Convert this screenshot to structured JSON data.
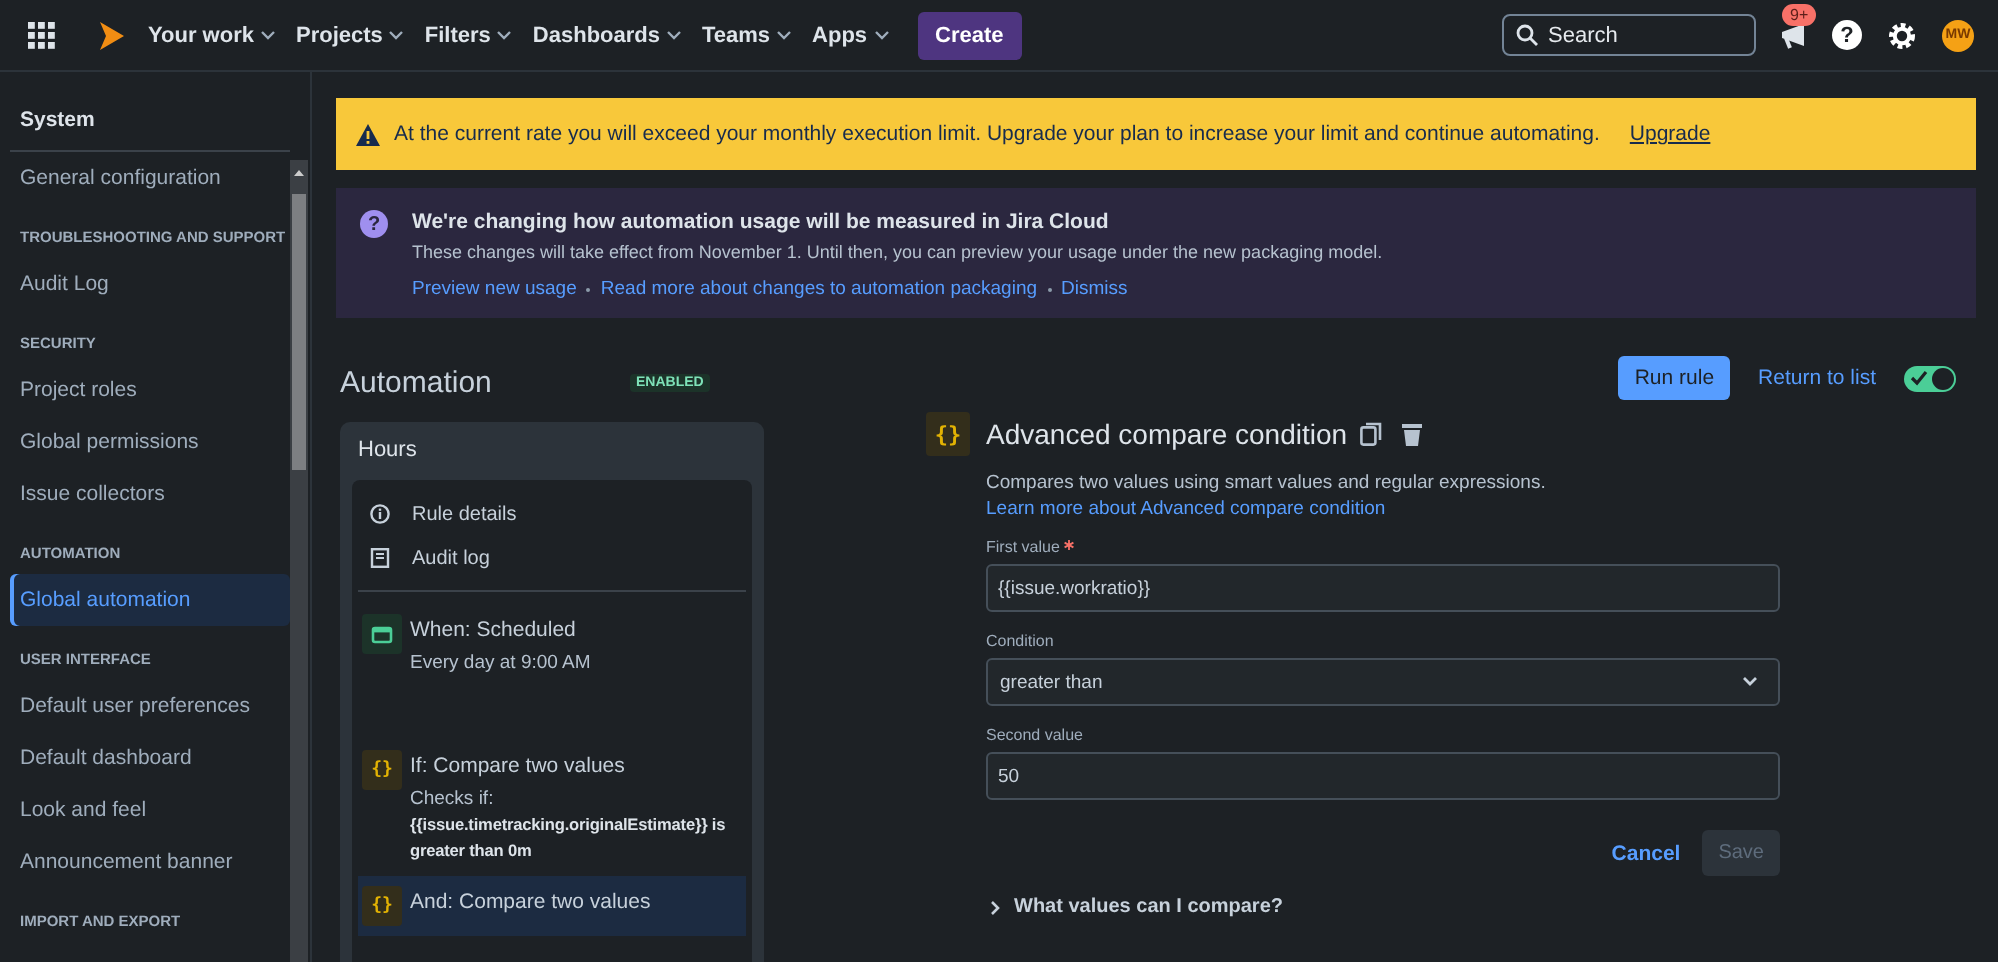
{
  "nav": {
    "menus": [
      {
        "label": "Your work"
      },
      {
        "label": "Projects"
      },
      {
        "label": "Filters"
      },
      {
        "label": "Dashboards"
      },
      {
        "label": "Teams"
      },
      {
        "label": "Apps"
      }
    ],
    "create": "Create",
    "search": {
      "placeholder": "Search"
    },
    "notifications": "9+",
    "help": "?",
    "avatar": "MW"
  },
  "sidebar": {
    "title": "System",
    "entries": [
      {
        "kind": "item",
        "label": "General configuration",
        "selected": false
      },
      {
        "kind": "heading",
        "label": "TROUBLESHOOTING AND SUPPORT"
      },
      {
        "kind": "item",
        "label": "Audit Log",
        "selected": false
      },
      {
        "kind": "heading",
        "label": "SECURITY"
      },
      {
        "kind": "item",
        "label": "Project roles",
        "selected": false
      },
      {
        "kind": "item",
        "label": "Global permissions",
        "selected": false
      },
      {
        "kind": "item",
        "label": "Issue collectors",
        "selected": false
      },
      {
        "kind": "heading",
        "label": "AUTOMATION"
      },
      {
        "kind": "item",
        "label": "Global automation",
        "selected": true
      },
      {
        "kind": "heading",
        "label": "USER INTERFACE"
      },
      {
        "kind": "item",
        "label": "Default user preferences",
        "selected": false
      },
      {
        "kind": "item",
        "label": "Default dashboard",
        "selected": false
      },
      {
        "kind": "item",
        "label": "Look and feel",
        "selected": false
      },
      {
        "kind": "item",
        "label": "Announcement banner",
        "selected": false
      },
      {
        "kind": "heading",
        "label": "IMPORT AND EXPORT"
      }
    ]
  },
  "warning": {
    "text": "At the current rate you will exceed your monthly execution limit. Upgrade your plan to increase your limit and continue automating.",
    "link": "Upgrade"
  },
  "notice": {
    "icon": "?",
    "title": "We're changing how automation usage will be measured in Jira Cloud",
    "body": "These changes will take effect from November 1. Until then, you can preview your usage under the new packaging model.",
    "links": [
      "Preview new usage",
      "Read more about changes to automation packaging",
      "Dismiss"
    ]
  },
  "rule": {
    "title": "Automation",
    "status": "ENABLED",
    "enabled": true,
    "run": "Run rule",
    "return": "Return to list"
  },
  "panel": {
    "name": "Hours",
    "menu": [
      {
        "kind": "info",
        "label": "Rule details"
      },
      {
        "kind": "log",
        "label": "Audit log"
      }
    ],
    "steps": [
      {
        "kind": "trigger",
        "title": "When: Scheduled",
        "detail": "Every day at 9:00 AM",
        "selected": false
      },
      {
        "kind": "condition",
        "icon": "{}",
        "title": "If: Compare two values",
        "detail": "Checks if: **{{issue.timetracking.originalEstimate}} is greater than 0m**",
        "selected": false
      },
      {
        "kind": "condition",
        "icon": "{}",
        "title": "And: Compare two values",
        "selected": true
      }
    ]
  },
  "editor": {
    "icon": "{}",
    "title": "Advanced compare condition",
    "description": "Compares two values using smart values and regular expressions.",
    "link": "Learn more about Advanced compare condition",
    "fields": [
      {
        "kind": "input",
        "label": "First value",
        "required": true,
        "value": "{{issue.workratio}}"
      },
      {
        "kind": "select",
        "label": "Condition",
        "required": false,
        "value": "greater than"
      },
      {
        "kind": "input",
        "label": "Second value",
        "required": false,
        "value": "50"
      }
    ],
    "cancel": "Cancel",
    "save": {
      "label": "Save",
      "disabled": true
    },
    "expander": "What values can I compare?"
  }
}
